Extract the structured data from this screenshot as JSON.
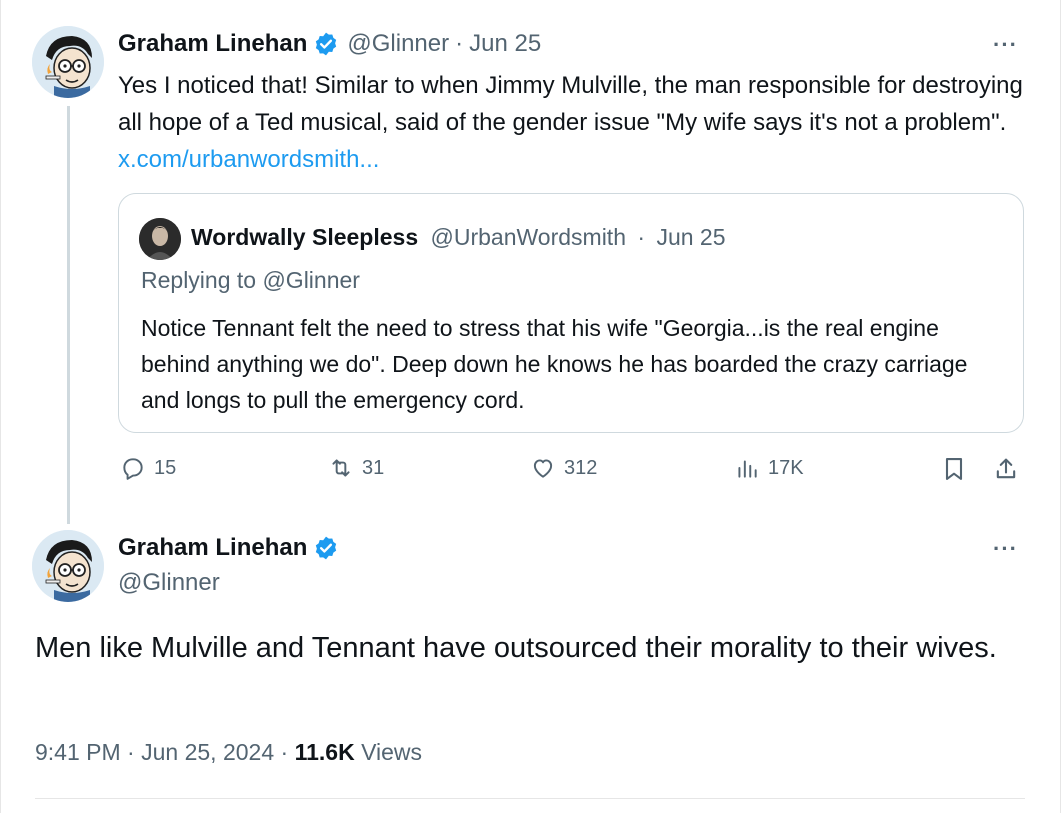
{
  "reply_tweet": {
    "author_name": "Graham Linehan",
    "handle": "@Glinner",
    "separator": "·",
    "date": "Jun 25",
    "text": "Yes I noticed that! Similar to when Jimmy Mulville, the man responsible for destroying all hope of a Ted musical, said of the gender issue \"My wife says it's not a problem\".",
    "link": "x.com/urbanwordsmith...",
    "more": "···",
    "quoted": {
      "author_name": "Wordwally Sleepless",
      "handle": "@UrbanWordsmith",
      "separator": "·",
      "date": "Jun 25",
      "replying_to": "Replying to @Glinner",
      "text": "Notice Tennant felt the need to stress that his wife \"Georgia...is the real engine behind anything we do\". Deep down he knows he has boarded the crazy carriage and longs to pull the emergency cord."
    },
    "actions": {
      "replies": "15",
      "reposts": "31",
      "likes": "312",
      "views": "17K"
    }
  },
  "main_tweet": {
    "author_name": "Graham Linehan",
    "handle": "@Glinner",
    "more": "···",
    "text": "Men like Mulville and Tennant have outsourced their morality to their wives.",
    "time": "9:41 PM",
    "separator": "·",
    "date": "Jun 25, 2024",
    "views_count": "11.6K",
    "views_label": "Views"
  },
  "icons": {
    "verified": "verified-badge-icon",
    "reply": "reply-icon",
    "repost": "repost-icon",
    "like": "heart-icon",
    "views": "views-chart-icon",
    "bookmark": "bookmark-icon",
    "share": "share-icon"
  },
  "colors": {
    "link": "#1d9bf0",
    "verified": "#1d9bf0",
    "muted": "#536471",
    "text": "#0f1419",
    "border": "#cfd9de"
  }
}
